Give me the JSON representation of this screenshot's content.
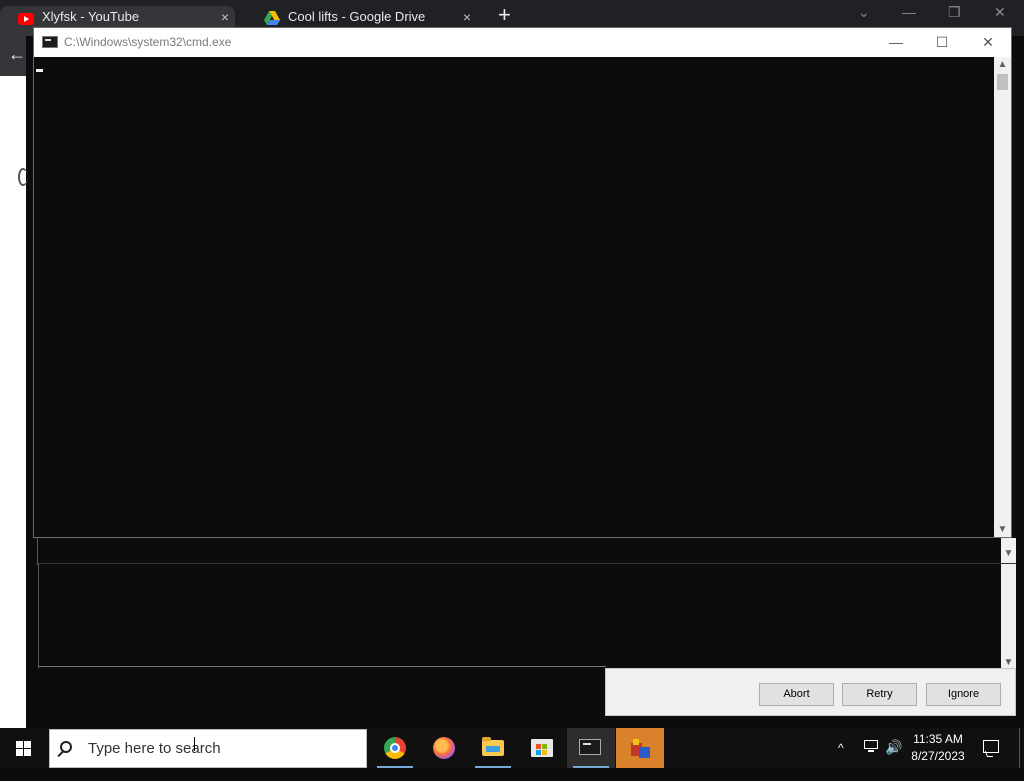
{
  "browser": {
    "tabs": [
      {
        "title": "Xlyfsk - YouTube",
        "close": "×"
      },
      {
        "title": "Cool lifts - Google Drive",
        "close": "×"
      }
    ],
    "new_tab": "+",
    "back": "←",
    "controls": {
      "minimize": "⌄",
      "min": "—",
      "restore": "❐",
      "close": "✕"
    }
  },
  "cmd": {
    "title": "C:\\Windows\\system32\\cmd.exe",
    "controls": {
      "minimize": "—",
      "maximize": "☐",
      "close": "✕"
    },
    "scroll": {
      "up": "▲",
      "down": "▼"
    }
  },
  "dialog": {
    "buttons": {
      "abort": "Abort",
      "retry": "Retry",
      "ignore": "Ignore"
    }
  },
  "taskbar": {
    "search_placeholder": "Type here to search",
    "apps": [
      "chrome-icon",
      "firefox-icon",
      "file-explorer-icon",
      "microsoft-store-icon",
      "cmd-icon",
      "app-icon"
    ],
    "tray": {
      "chevron": "^",
      "volume": "🔊"
    },
    "clock": {
      "time": "11:35 AM",
      "date": "8/27/2023"
    },
    "colors": {
      "taskbar": "#101010",
      "active_app": "#d9822b"
    }
  }
}
